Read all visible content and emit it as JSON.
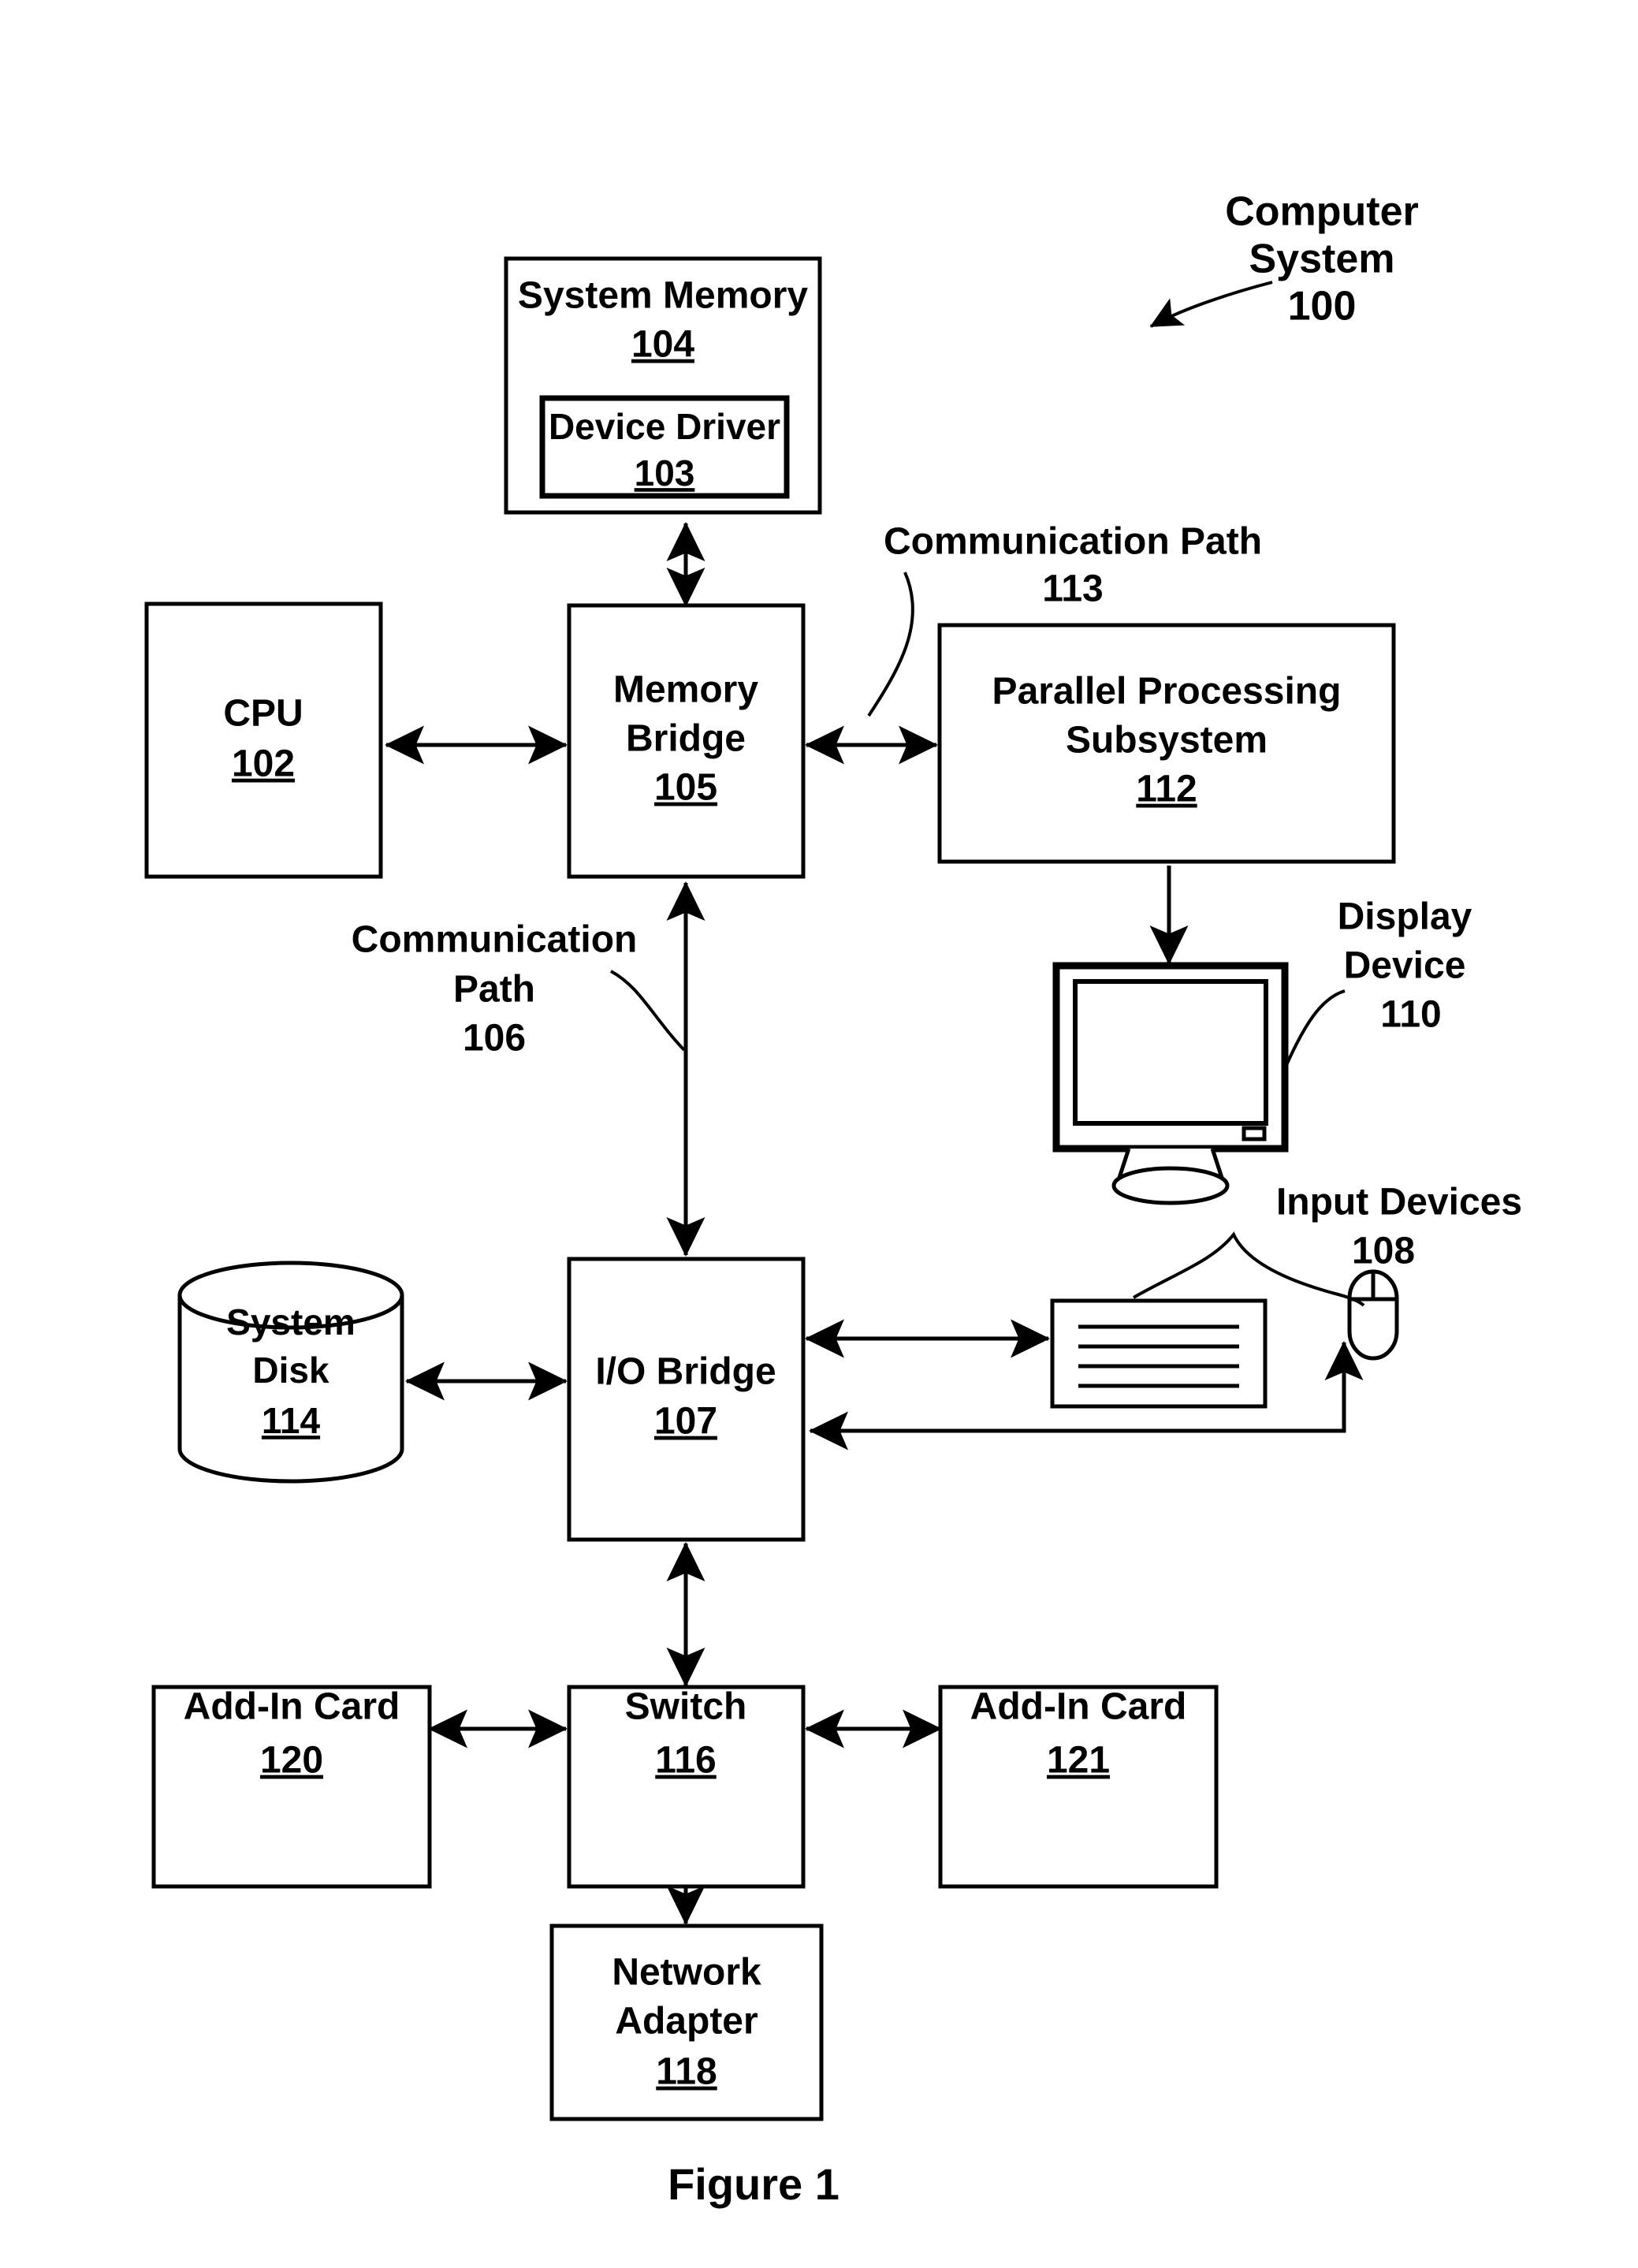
{
  "figure": {
    "caption": "Figure 1",
    "title_annotation": {
      "line1": "Computer",
      "line2": "System",
      "number": "100"
    }
  },
  "blocks": {
    "system_memory": {
      "label": "System Memory",
      "number": "104"
    },
    "device_driver": {
      "label": "Device Driver",
      "number": "103"
    },
    "cpu": {
      "label": "CPU",
      "number": "102"
    },
    "memory_bridge": {
      "label_line1": "Memory",
      "label_line2": "Bridge",
      "number": "105"
    },
    "parallel_processing_subsystem": {
      "label_line1": "Parallel Processing",
      "label_line2": "Subsystem",
      "number": "112"
    },
    "io_bridge": {
      "label": "I/O Bridge",
      "number": "107"
    },
    "system_disk": {
      "label_line1": "System",
      "label_line2": "Disk",
      "number": "114"
    },
    "switch": {
      "label": "Switch",
      "number": "116"
    },
    "add_in_card_left": {
      "label": "Add-In Card",
      "number": "120"
    },
    "add_in_card_right": {
      "label": "Add-In Card",
      "number": "121"
    },
    "network_adapter": {
      "label_line1": "Network",
      "label_line2": "Adapter",
      "number": "118"
    }
  },
  "annotations": {
    "communication_path_113": {
      "line1": "Communication Path",
      "number": "113"
    },
    "communication_path_106": {
      "line1": "Communication",
      "line2": "Path",
      "number": "106"
    },
    "display_device_110": {
      "line1": "Display",
      "line2": "Device",
      "number": "110"
    },
    "input_devices_108": {
      "line1": "Input Devices",
      "number": "108"
    }
  },
  "icons": {
    "display_device": "monitor-icon",
    "keyboard": "keyboard-icon",
    "mouse": "mouse-icon",
    "system_disk": "cylinder-database-icon"
  },
  "colors": {
    "stroke": "#000000",
    "fill": "#ffffff"
  }
}
